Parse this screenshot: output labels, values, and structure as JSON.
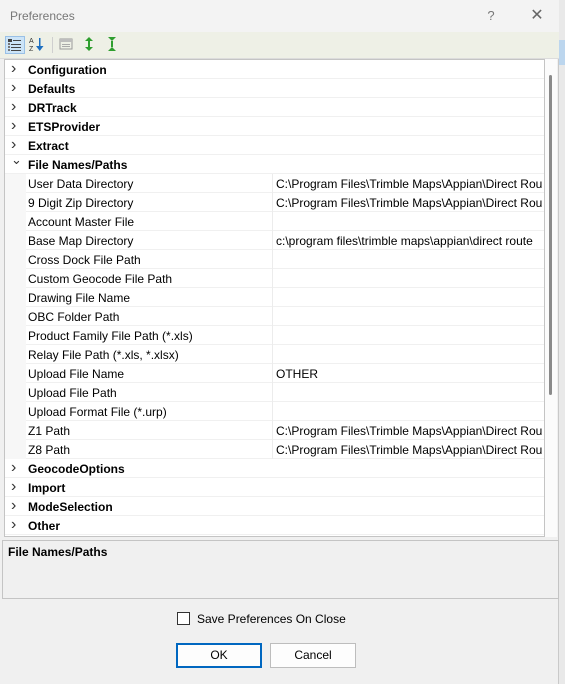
{
  "window": {
    "title": "Preferences",
    "help_glyph": "?",
    "close_glyph": "✕"
  },
  "toolbar": {
    "buttons": [
      "categorized-view",
      "alphabetical-sort",
      "property-pages",
      "expand-all",
      "collapse-all"
    ]
  },
  "grid": {
    "rows": [
      {
        "kind": "category",
        "label": "Configuration",
        "expanded": false
      },
      {
        "kind": "category",
        "label": "Defaults",
        "expanded": false
      },
      {
        "kind": "category",
        "label": "DRTrack",
        "expanded": false
      },
      {
        "kind": "category",
        "label": "ETSProvider",
        "expanded": false
      },
      {
        "kind": "category",
        "label": "Extract",
        "expanded": false
      },
      {
        "kind": "category",
        "label": "File Names/Paths",
        "expanded": true
      },
      {
        "kind": "property",
        "name": "User Data Directory",
        "value": "C:\\Program Files\\Trimble Maps\\Appian\\Direct Rou"
      },
      {
        "kind": "property",
        "name": "9 Digit Zip Directory",
        "value": "C:\\Program Files\\Trimble Maps\\Appian\\Direct Rou"
      },
      {
        "kind": "property",
        "name": "Account Master File",
        "value": ""
      },
      {
        "kind": "property",
        "name": "Base Map Directory",
        "value": "c:\\program files\\trimble maps\\appian\\direct route"
      },
      {
        "kind": "property",
        "name": "Cross Dock File Path",
        "value": ""
      },
      {
        "kind": "property",
        "name": "Custom Geocode File Path",
        "value": ""
      },
      {
        "kind": "property",
        "name": "Drawing File Name",
        "value": ""
      },
      {
        "kind": "property",
        "name": "OBC Folder Path",
        "value": ""
      },
      {
        "kind": "property",
        "name": "Product Family File Path (*.xls)",
        "value": ""
      },
      {
        "kind": "property",
        "name": "Relay File Path (*.xls, *.xlsx)",
        "value": ""
      },
      {
        "kind": "property",
        "name": "Upload File Name",
        "value": "OTHER"
      },
      {
        "kind": "property",
        "name": "Upload File Path",
        "value": ""
      },
      {
        "kind": "property",
        "name": "Upload Format File (*.urp)",
        "value": ""
      },
      {
        "kind": "property",
        "name": "Z1 Path",
        "value": "C:\\Program Files\\Trimble Maps\\Appian\\Direct Rou"
      },
      {
        "kind": "property",
        "name": "Z8 Path",
        "value": "C:\\Program Files\\Trimble Maps\\Appian\\Direct Rou"
      },
      {
        "kind": "category",
        "label": "GeocodeOptions",
        "expanded": false
      },
      {
        "kind": "category",
        "label": "Import",
        "expanded": false
      },
      {
        "kind": "category",
        "label": "ModeSelection",
        "expanded": false
      },
      {
        "kind": "category",
        "label": "Other",
        "expanded": false
      }
    ]
  },
  "description": {
    "title": "File Names/Paths"
  },
  "footer": {
    "save_on_close_label": "Save Preferences On Close",
    "save_on_close_checked": false,
    "ok_label": "OK",
    "cancel_label": "Cancel"
  },
  "colors": {
    "accent": "#0067c0",
    "selected_toolbar": "#cce4f7"
  }
}
